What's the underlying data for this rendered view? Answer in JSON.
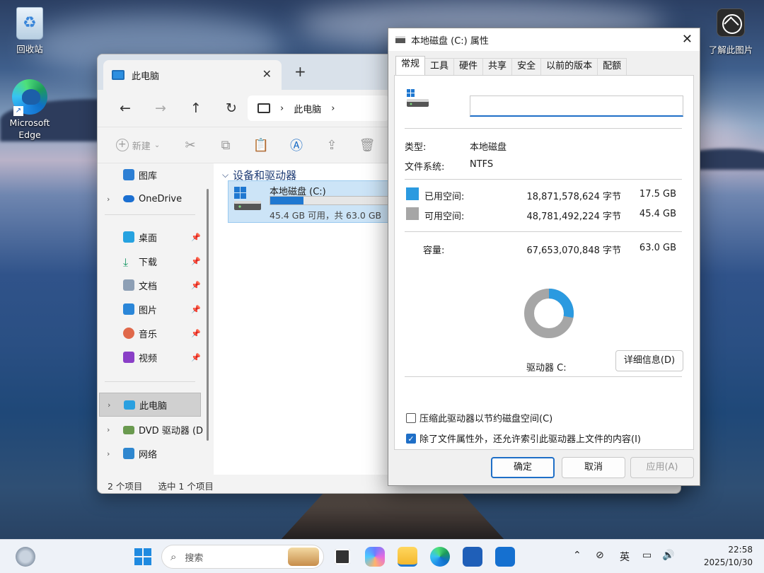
{
  "desktop": {
    "icons": [
      {
        "label": "回收站"
      },
      {
        "label": "Microsoft Edge"
      },
      {
        "label": "了解此图片"
      }
    ]
  },
  "explorer": {
    "tab_title": "此电脑",
    "breadcrumb": [
      "此电脑"
    ],
    "toolbar": {
      "new_label": "新建"
    },
    "sidebar": {
      "items": [
        {
          "label": "图库",
          "icon": "gallery-icon"
        },
        {
          "label": "OneDrive",
          "icon": "onedrive-icon"
        },
        {
          "label": "桌面",
          "icon": "desktop-folder-icon"
        },
        {
          "label": "下载",
          "icon": "download-icon"
        },
        {
          "label": "文档",
          "icon": "documents-icon"
        },
        {
          "label": "图片",
          "icon": "pictures-icon"
        },
        {
          "label": "音乐",
          "icon": "music-icon"
        },
        {
          "label": "视频",
          "icon": "videos-icon"
        },
        {
          "label": "此电脑",
          "icon": "this-pc-icon"
        },
        {
          "label": "DVD 驱动器 (D",
          "icon": "dvd-drive-icon"
        },
        {
          "label": "网络",
          "icon": "network-icon"
        }
      ]
    },
    "group_header": "设备和驱动器",
    "drive": {
      "name": "本地磁盘 (C:)",
      "free_text": "45.4 GB 可用，共 63.0 GB",
      "used_fraction": 0.28
    },
    "status": {
      "count": "2 个项目",
      "selected": "选中 1 个项目"
    }
  },
  "dialog": {
    "title": "本地磁盘 (C:) 属性",
    "tabs": [
      "常规",
      "工具",
      "硬件",
      "共享",
      "安全",
      "以前的版本",
      "配额"
    ],
    "name_value": "",
    "type_label": "类型:",
    "type_value": "本地磁盘",
    "fs_label": "文件系统:",
    "fs_value": "NTFS",
    "used": {
      "label": "已用空间:",
      "bytes": "18,871,578,624 字节",
      "gb": "17.5 GB",
      "color": "#2b9ae0"
    },
    "free": {
      "label": "可用空间:",
      "bytes": "48,781,492,224 字节",
      "gb": "45.4 GB",
      "color": "#a6a6a6"
    },
    "capacity": {
      "label": "容量:",
      "bytes": "67,653,070,848 字节",
      "gb": "63.0 GB"
    },
    "drive_label": "驱动器 C:",
    "details_button": "详细信息(D)",
    "compress_label": "压缩此驱动器以节约磁盘空间(C)",
    "compress_checked": false,
    "index_label": "除了文件属性外，还允许索引此驱动器上文件的内容(I)",
    "index_checked": true,
    "ok": "确定",
    "cancel": "取消",
    "apply": "应用(A)"
  },
  "taskbar": {
    "search_placeholder": "搜索",
    "ime": "英",
    "time": "22:58",
    "date": "2025/10/30"
  }
}
